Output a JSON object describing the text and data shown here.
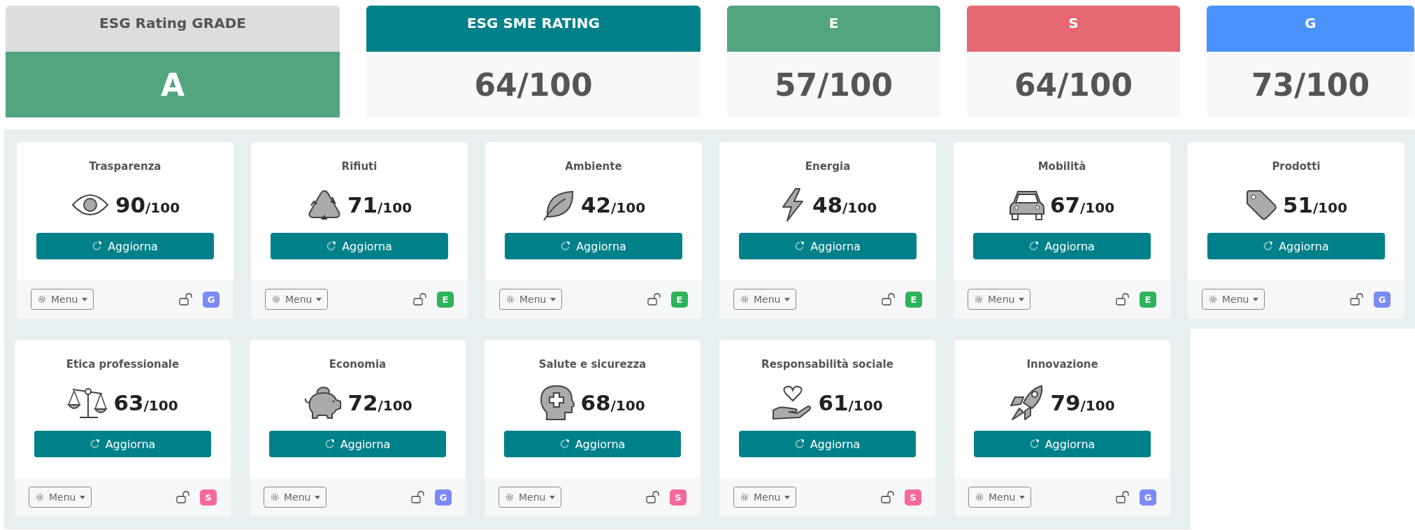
{
  "grade": {
    "title": "ESG Rating GRADE",
    "value": "A"
  },
  "scores": [
    {
      "title": "ESG SME RATING",
      "value": "64/100",
      "color": "#00818a"
    },
    {
      "title": "E",
      "value": "57/100",
      "color": "#53a57f"
    },
    {
      "title": "S",
      "value": "64/100",
      "color": "#e66873"
    },
    {
      "title": "G",
      "value": "73/100",
      "color": "#4a92fe"
    }
  ],
  "rows": [
    {
      "cards": [
        {
          "title": "Trasparenza",
          "score": "90",
          "max": "/100",
          "button": "Aggiorna",
          "menu": "Menu",
          "pillar": "G",
          "color": "#7b8af7"
        },
        {
          "title": "Rifiuti",
          "score": "71",
          "max": "/100",
          "button": "Aggiorna",
          "menu": "Menu",
          "pillar": "E",
          "color": "#2fb35a"
        },
        {
          "title": "Ambiente",
          "score": "42",
          "max": "/100",
          "button": "Aggiorna",
          "menu": "Menu",
          "pillar": "E",
          "color": "#2fb35a"
        },
        {
          "title": "Energia",
          "score": "48",
          "max": "/100",
          "button": "Aggiorna",
          "menu": "Menu",
          "pillar": "E",
          "color": "#2fb35a"
        },
        {
          "title": "Mobilità",
          "score": "67",
          "max": "/100",
          "button": "Aggiorna",
          "menu": "Menu",
          "pillar": "E",
          "color": "#2fb35a"
        },
        {
          "title": "Prodotti",
          "score": "51",
          "max": "/100",
          "button": "Aggiorna",
          "menu": "Menu",
          "pillar": "G",
          "color": "#7b8af7"
        }
      ]
    },
    {
      "cards": [
        {
          "title": "Etica professionale",
          "score": "63",
          "max": "/100",
          "button": "Aggiorna",
          "menu": "Menu",
          "pillar": "S",
          "color": "#f5689b"
        },
        {
          "title": "Economia",
          "score": "72",
          "max": "/100",
          "button": "Aggiorna",
          "menu": "Menu",
          "pillar": "G",
          "color": "#7b8af7"
        },
        {
          "title": "Salute e sicurezza",
          "score": "68",
          "max": "/100",
          "button": "Aggiorna",
          "menu": "Menu",
          "pillar": "S",
          "color": "#f5689b"
        },
        {
          "title": "Responsabilità sociale",
          "score": "61",
          "max": "/100",
          "button": "Aggiorna",
          "menu": "Menu",
          "pillar": "S",
          "color": "#f5689b"
        },
        {
          "title": "Innovazione",
          "score": "79",
          "max": "/100",
          "button": "Aggiorna",
          "menu": "Menu",
          "pillar": "G",
          "color": "#7b8af7"
        }
      ]
    }
  ]
}
